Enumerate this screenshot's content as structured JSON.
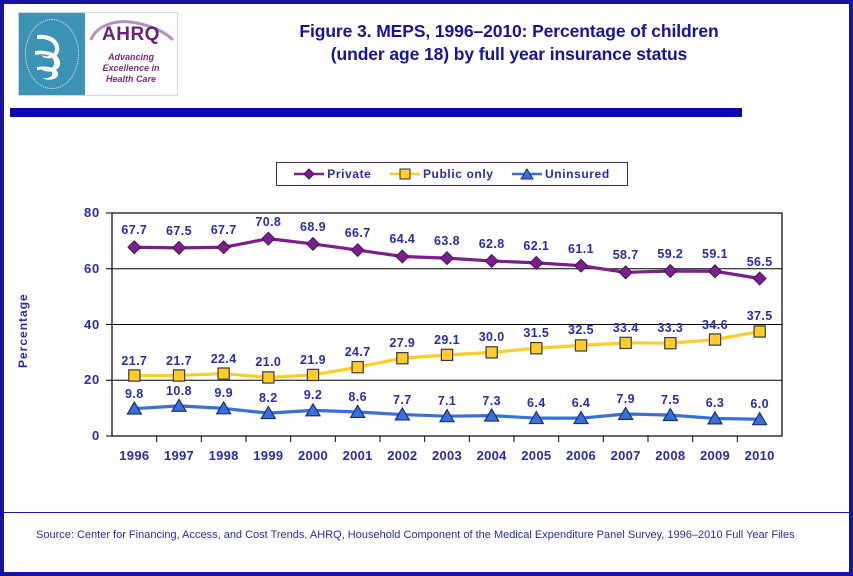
{
  "header": {
    "title_line1": "Figure 3. MEPS, 1996–2010: Percentage of children",
    "title_line2": "(under age 18) by full year insurance status",
    "logo": {
      "seal_name": "hhs-seal",
      "brand": "AHRQ",
      "tagline_line1": "Advancing",
      "tagline_line2": "Excellence in",
      "tagline_line3": "Health Care"
    }
  },
  "footer": {
    "source": "Source: Center for Financing, Access, and Cost Trends, AHRQ, Household Component of the Medical Expenditure Panel Survey,  1996–2010 Full Year Files"
  },
  "colors": {
    "border": "#1712a0",
    "title": "#1712a0",
    "rule": "#1008a8",
    "text_blue": "#2b2bb0",
    "private": "#7b1f8c",
    "public": "#ffcc29",
    "uninsured": "#3a6fd8",
    "plot_frame": "#000000"
  },
  "chart_data": {
    "type": "line",
    "title": "Figure 3. MEPS, 1996–2010: Percentage of children (under age 18) by full year insurance status",
    "xlabel": "",
    "ylabel": "Percentage",
    "ylim": [
      0,
      80
    ],
    "yticks": [
      0,
      20,
      40,
      60,
      80
    ],
    "grid": true,
    "legend_position": "top-center",
    "categories": [
      "1996",
      "1997",
      "1998",
      "1999",
      "2000",
      "2001",
      "2002",
      "2003",
      "2004",
      "2005",
      "2006",
      "2007",
      "2008",
      "2009",
      "2010"
    ],
    "series": [
      {
        "name": "Private",
        "color": "#7b1f8c",
        "marker": "diamond",
        "values": [
          67.7,
          67.5,
          67.7,
          70.8,
          68.9,
          66.7,
          64.4,
          63.8,
          62.8,
          62.1,
          61.1,
          58.7,
          59.2,
          59.1,
          56.5
        ]
      },
      {
        "name": "Public only",
        "color": "#ffcc29",
        "marker": "square",
        "values": [
          21.7,
          21.7,
          22.4,
          21.0,
          21.9,
          24.7,
          27.9,
          29.1,
          30.0,
          31.5,
          32.5,
          33.4,
          33.3,
          34.6,
          37.5
        ]
      },
      {
        "name": "Uninsured",
        "color": "#3a6fd8",
        "marker": "triangle",
        "values": [
          9.8,
          10.8,
          9.9,
          8.2,
          9.2,
          8.6,
          7.7,
          7.1,
          7.3,
          6.4,
          6.4,
          7.9,
          7.5,
          6.3,
          6.0
        ]
      }
    ]
  }
}
